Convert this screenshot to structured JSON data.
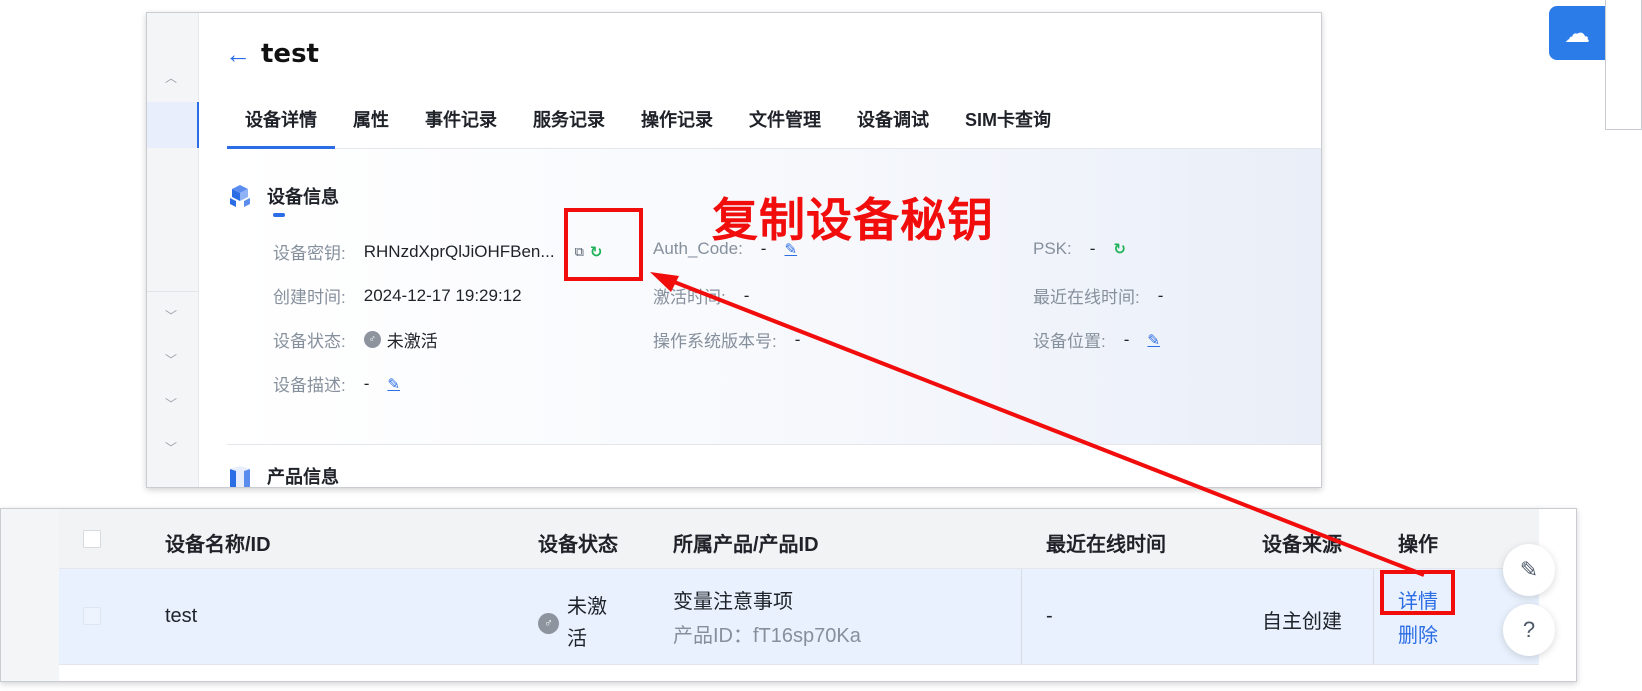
{
  "detail": {
    "title": "test",
    "tabs": [
      "设备详情",
      "属性",
      "事件记录",
      "服务记录",
      "操作记录",
      "文件管理",
      "设备调试",
      "SIM卡查询"
    ],
    "device_info": {
      "section_title": "设备信息",
      "secret_label": "设备密钥:",
      "secret_value": "RHNzdXprQlJiOHFBen...",
      "auth_label": "Auth_Code:",
      "auth_value": "-",
      "psk_label": "PSK:",
      "psk_value": "-",
      "created_label": "创建时间:",
      "created_value": "2024-12-17 19:29:12",
      "activated_label": "激活时间:",
      "activated_value": "-",
      "last_online_label": "最近在线时间:",
      "last_online_value": "-",
      "status_label": "设备状态:",
      "status_value": "未激活",
      "os_label": "操作系统版本号:",
      "os_value": "-",
      "location_label": "设备位置:",
      "location_value": "-",
      "desc_label": "设备描述:",
      "desc_value": "-"
    },
    "product_section_title": "产品信息"
  },
  "annotation": {
    "text": "复制设备秘钥",
    "color": "#f20d0d"
  },
  "list": {
    "headers": {
      "name": "设备名称/ID",
      "status": "设备状态",
      "product": "所属产品/产品ID",
      "last_online": "最近在线时间",
      "source": "设备来源",
      "actions": "操作"
    },
    "row": {
      "name": "test",
      "status_line1": "未激",
      "status_line2": "活",
      "product_name": "变量注意事项",
      "product_id": "产品ID：fT16sp70Ka",
      "last_online": "-",
      "source": "自主创建",
      "action_detail": "详情",
      "action_delete": "删除"
    }
  },
  "colors": {
    "accent": "#2b6de5",
    "success": "#21b35a",
    "annotation": "#f20d0d"
  }
}
